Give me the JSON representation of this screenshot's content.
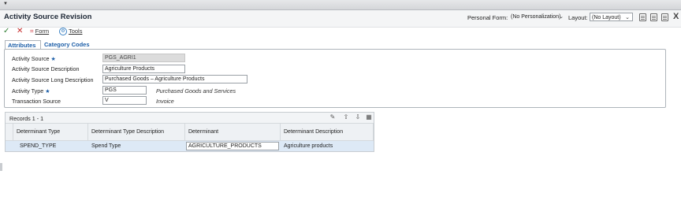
{
  "window": {
    "title": "Activity Source Revision",
    "personal_form_label": "Personal Form:",
    "personal_form_value": "(No Personalization)",
    "layout_label": "Layout:",
    "layout_value": "(No Layout)",
    "close_glyph": "X"
  },
  "toolbar": {
    "form_label": "Form",
    "tools_label": "Tools"
  },
  "tabs": [
    {
      "label": "Attributes",
      "active": true
    },
    {
      "label": "Category Codes",
      "active": false
    }
  ],
  "fields": {
    "activity_source": {
      "label": "Activity Source",
      "value": "PGS_AGRI1",
      "required": true
    },
    "activity_source_description": {
      "label": "Activity Source Description",
      "value": "Agriculture Products"
    },
    "activity_source_long_description": {
      "label": "Activity Source Long Description",
      "value": "Purchased Goods – Agriculture Products"
    },
    "activity_type": {
      "label": "Activity Type",
      "value": "PGS",
      "required": true,
      "description": "Purchased Goods and Services"
    },
    "transaction_source": {
      "label": "Transaction Source",
      "value": "V",
      "description": "Invoice"
    }
  },
  "required_marker": "★",
  "grid": {
    "records_label": "Records 1 - 1",
    "columns": [
      "Determinant Type",
      "Determinant Type Description",
      "Determinant",
      "Determinant Description"
    ],
    "rows": [
      [
        "SPEND_TYPE",
        "Spend Type",
        "AGRICULTURE_PRODUCTS",
        "Agriculture products"
      ]
    ]
  }
}
